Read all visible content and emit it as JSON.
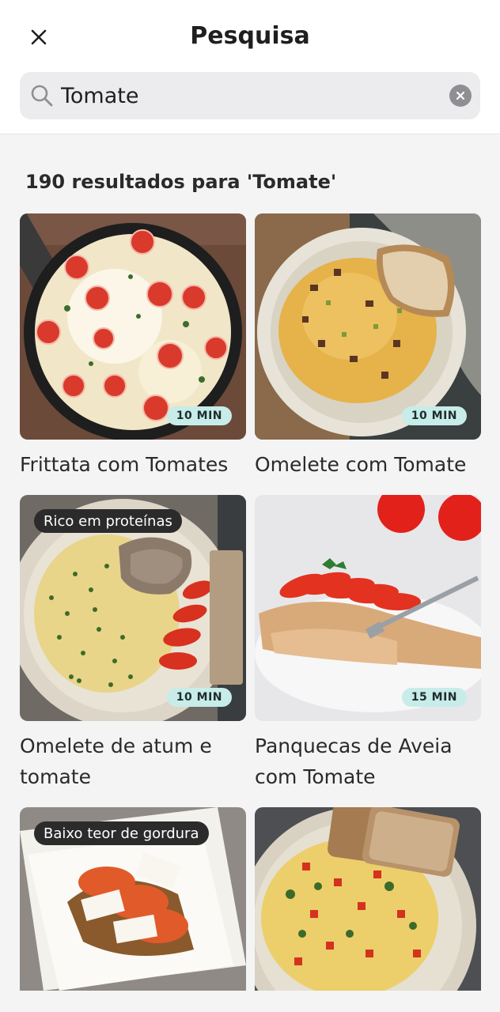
{
  "header": {
    "title": "Pesquisa",
    "close_icon": "close-icon"
  },
  "search": {
    "value": "Tomate",
    "icon": "search-icon",
    "clear_icon": "clear-icon"
  },
  "results": {
    "summary": "190 resultados para 'Tomate'",
    "cards": [
      {
        "title": "Frittata com Tomates",
        "time": "10 MIN",
        "tag": ""
      },
      {
        "title": "Omelete com Tomate",
        "time": "10 MIN",
        "tag": ""
      },
      {
        "title": "Omelete de atum e tomate",
        "time": "10 MIN",
        "tag": "Rico em proteínas"
      },
      {
        "title": "Panquecas de Aveia com Tomate",
        "time": "15 MIN",
        "tag": ""
      },
      {
        "title": "",
        "time": "",
        "tag": "Baixo teor de gordura"
      },
      {
        "title": "",
        "time": "",
        "tag": ""
      }
    ]
  },
  "colors": {
    "time_badge_bg": "#c7ece9",
    "tag_badge_bg": "#2b2b2b",
    "page_bg": "#f4f4f5"
  }
}
